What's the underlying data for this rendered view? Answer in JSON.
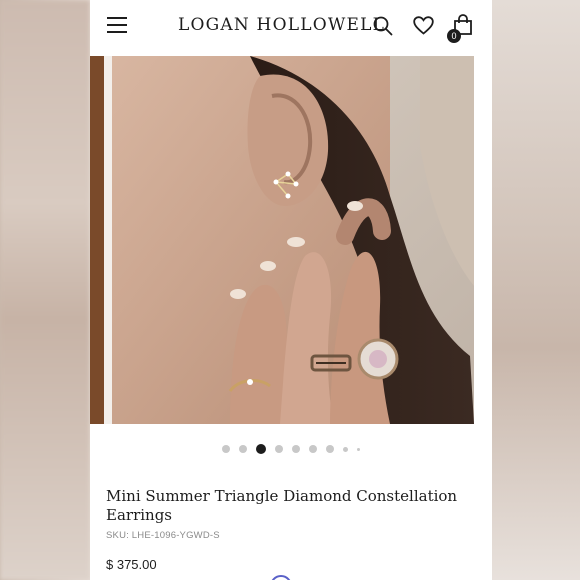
{
  "header": {
    "brand": "LOGAN HOLLOWELL",
    "cart_count": "0",
    "icons": [
      "hamburger-menu-icon",
      "search-icon",
      "heart-icon",
      "shopping-bag-icon"
    ]
  },
  "gallery": {
    "slide_count": 9,
    "active_index": 2
  },
  "product": {
    "title": "Mini Summer Triangle Diamond Constellation Earrings",
    "sku": "SKU: LHE-1096-YGWD-S",
    "price": "$ 375.00"
  },
  "colors": {
    "text": "#1d1d1d",
    "dot_inactive": "#c8c8c8",
    "dot_active": "#1d1d1d"
  }
}
